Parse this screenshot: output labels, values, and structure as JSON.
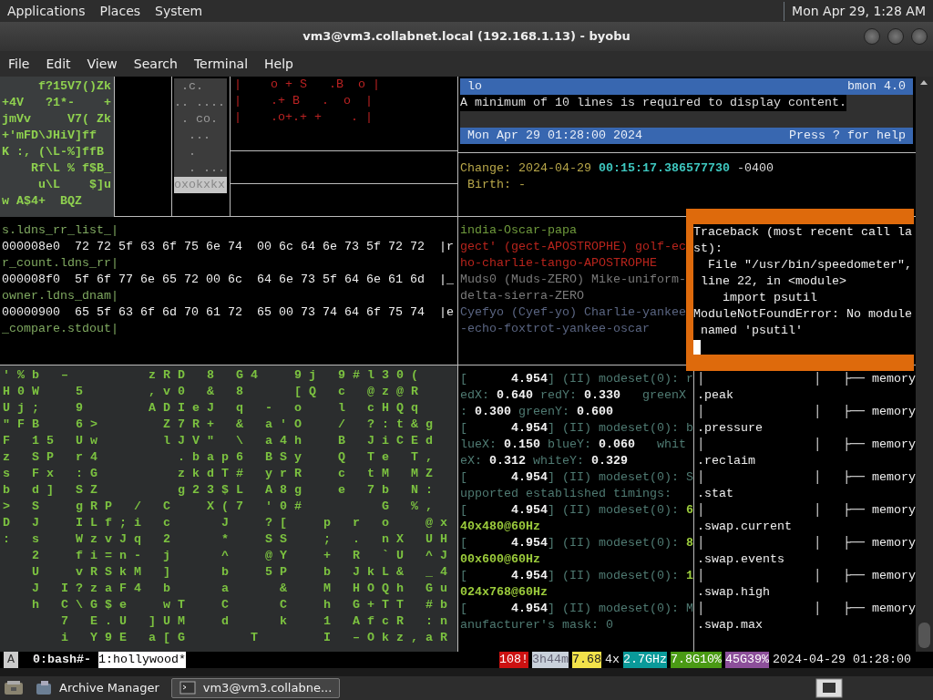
{
  "top_panel": {
    "menus": [
      "Applications",
      "Places",
      "System"
    ],
    "clock": "Mon Apr 29, 1:28 AM"
  },
  "window": {
    "title": "vm3@vm3.collabnet.local (192.168.1.13) - byobu"
  },
  "menu_bar": [
    "File",
    "Edit",
    "View",
    "Search",
    "Terminal",
    "Help"
  ],
  "matrix_small": [
    "     f?15V7()Zk",
    "+4V   ?1*-    +",
    "jmVv     V7( Zk",
    "+'mFD\\JHiV]ff",
    "K :, (\\L-%]ffB",
    "    Rf\\L % f$B_",
    "     u\\L    $]u",
    "w A$4+  BQZ"
  ],
  "shade_pane": [
    {
      "text": " .c.",
      "selected": false
    },
    {
      "text": ".. ....",
      "selected": false
    },
    {
      "text": " . co.",
      "selected": false
    },
    {
      "text": "  ...",
      "selected": false
    },
    {
      "text": "  .",
      "selected": false
    },
    {
      "text": "  . ...",
      "selected": false
    },
    {
      "text": "oxokxkx",
      "selected": true
    }
  ],
  "randomart": [
    "|    o + S   .B  o |",
    "|    .+ B   .  o  |",
    "|    .o+.+ +    . |"
  ],
  "bmon": {
    "interface": "lo",
    "version": "bmon 4.0",
    "message": "A minimum of 10 lines is required to display content.",
    "date": "Mon Apr 29 01:28:00 2024",
    "help": "Press ? for help"
  },
  "stat": {
    "change_label": "Change:",
    "change_date": "2024-04-29",
    "change_time": "00:15:17.386577730",
    "change_zone": "-0400",
    "birth": " Birth: -"
  },
  "hexdump": [
    {
      "text": "s.ldns_rr_list_|",
      "kind": "ascii"
    },
    {
      "text": "000008e0  72 72 5f 63 6f 75 6e 74  00 6c 64 6e 73 5f 72 72  |r",
      "kind": "hex"
    },
    {
      "text": "r_count.ldns_rr|",
      "kind": "ascii"
    },
    {
      "text": "000008f0  5f 6f 77 6e 65 72 00 6c  64 6e 73 5f 64 6e 61 6d  |_",
      "kind": "hex"
    },
    {
      "text": "owner.ldns_dnam|",
      "kind": "ascii"
    },
    {
      "text": "00000900  65 5f 63 6f 6d 70 61 72  65 00 73 74 64 6f 75 74  |e",
      "kind": "hex"
    },
    {
      "text": "_compare.stdout|",
      "kind": "ascii"
    }
  ],
  "words": [
    {
      "text": "india-Oscar-papa",
      "color": "#6f9a3c"
    },
    {
      "text": "gect' (gect-APOSTROPHE) golf-ec",
      "color": "#b8241c"
    },
    {
      "text": "ho-charlie-tango-APOSTROPHE",
      "color": "#b8241c"
    },
    {
      "text": "Muds0 (Muds-ZERO) Mike-uniform-",
      "color": "#7a7a7a"
    },
    {
      "text": "delta-sierra-ZERO",
      "color": "#7a7a7a"
    },
    {
      "text": "Cyefyo (Cyef-yo) Charlie-yankee",
      "color": "#5a6582"
    },
    {
      "text": "-echo-foxtrot-yankee-oscar",
      "color": "#5a6582"
    }
  ],
  "traceback": {
    "lines": [
      "Traceback (most recent call la",
      "st):",
      "  File \"/usr/bin/speedometer\",",
      " line 22, in <module>",
      "    import psutil",
      "ModuleNotFoundError: No module",
      " named 'psutil'"
    ],
    "cursor": true
  },
  "matrix_rain": [
    "'%b –     zRD 8 G4  9j 9#l30(",
    "H0W  5    ,v0 & 8   [Q c @z@R",
    "Uj;  9    ADIeJ q - o  l cHQq",
    "\"FB  6>    Z7R+ & a'O  / ?:t&g",
    "F 15 Uw    lJV\" \\ a4h  B JiCEd",
    "z SP r4     .bap6 BSy  Q Te T,",
    "s Fx :G     zkdT# yrR  c tM MZ",
    "b d] SZ     g23$L A8g  e 7b N:",
    "> S  gRP / C  X(7 '0#     G %,",
    "D J  ILf;i c   J  ?[  p r o  @x",
    ": s  WzvJq 2   *  SS  ; . nX UH",
    "  2  fi=n- j   ^  @Y  + R `U ^J",
    "  U  vRSkM ]   b  5P  b JkL& _4",
    "  J I?zaF4 b   a   &  M HOQh Gu",
    "  h C\\G$e  wT  C   C  h G+TT #b",
    "    7 E.U ]UM  d   k  1 AfcR :n",
    "    i Y9E a[G    T    I –Okz,aR"
  ],
  "dmesg": [
    [
      {
        "text": "[      ",
        "kind": "dim"
      },
      {
        "text": "4.954",
        "kind": "bold"
      },
      {
        "text": "] (II) modeset(0): r",
        "kind": "dim"
      }
    ],
    [
      {
        "text": "edX: ",
        "kind": "dim"
      },
      {
        "text": "0.640",
        "kind": "bold"
      },
      {
        "text": " redY: ",
        "kind": "dim"
      },
      {
        "text": "0.330",
        "kind": "bold"
      },
      {
        "text": "   greenX",
        "kind": "dim"
      }
    ],
    [
      {
        "text": ": ",
        "kind": "dim"
      },
      {
        "text": "0.300",
        "kind": "bold"
      },
      {
        "text": " greenY: ",
        "kind": "dim"
      },
      {
        "text": "0.600",
        "kind": "bold"
      }
    ],
    [
      {
        "text": "[      ",
        "kind": "dim"
      },
      {
        "text": "4.954",
        "kind": "bold"
      },
      {
        "text": "] (II) modeset(0): b",
        "kind": "dim"
      }
    ],
    [
      {
        "text": "lueX: ",
        "kind": "dim"
      },
      {
        "text": "0.150",
        "kind": "bold"
      },
      {
        "text": " blueY: ",
        "kind": "dim"
      },
      {
        "text": "0.060",
        "kind": "bold"
      },
      {
        "text": "   whit",
        "kind": "dim"
      }
    ],
    [
      {
        "text": "eX: ",
        "kind": "dim"
      },
      {
        "text": "0.312",
        "kind": "bold"
      },
      {
        "text": " whiteY: ",
        "kind": "dim"
      },
      {
        "text": "0.329",
        "kind": "bold"
      }
    ],
    [
      {
        "text": "[      ",
        "kind": "dim"
      },
      {
        "text": "4.954",
        "kind": "bold"
      },
      {
        "text": "] (II) modeset(0): S",
        "kind": "dim"
      }
    ],
    [
      {
        "text": "upported established timings:",
        "kind": "dim"
      }
    ],
    [
      {
        "text": "[      ",
        "kind": "dim"
      },
      {
        "text": "4.954",
        "kind": "bold"
      },
      {
        "text": "] (II) modeset(0): ",
        "kind": "dim"
      },
      {
        "text": "6",
        "kind": "green"
      }
    ],
    [
      {
        "text": "40x480@60Hz",
        "kind": "green"
      }
    ],
    [
      {
        "text": "[      ",
        "kind": "dim"
      },
      {
        "text": "4.954",
        "kind": "bold"
      },
      {
        "text": "] (II) modeset(0): ",
        "kind": "dim"
      },
      {
        "text": "8",
        "kind": "green"
      }
    ],
    [
      {
        "text": "00x600@60Hz",
        "kind": "green"
      }
    ],
    [
      {
        "text": "[      ",
        "kind": "dim"
      },
      {
        "text": "4.954",
        "kind": "bold"
      },
      {
        "text": "] (II) modeset(0): ",
        "kind": "dim"
      },
      {
        "text": "1",
        "kind": "green"
      }
    ],
    [
      {
        "text": "024x768@60Hz",
        "kind": "green"
      }
    ],
    [
      {
        "text": "[      ",
        "kind": "dim"
      },
      {
        "text": "4.954",
        "kind": "bold"
      },
      {
        "text": "] (II) modeset(0): M",
        "kind": "dim"
      }
    ],
    [
      {
        "text": "anufacturer's mask: 0",
        "kind": "dim"
      }
    ]
  ],
  "tree": [
    "│               │   ├── memory",
    ".peak",
    "│               │   ├── memory",
    ".pressure",
    "│               │   ├── memory",
    ".reclaim",
    "│               │   ├── memory",
    ".stat",
    "│               │   ├── memory",
    ".swap.current",
    "│               │   ├── memory",
    ".swap.events",
    "│               │   ├── memory",
    ".swap.high",
    "│               │   ├── memory",
    ".swap.max"
  ],
  "status_bar": {
    "session": "A",
    "windows": [
      {
        "label": "0:bash#-",
        "selected": false
      },
      {
        "label": "1:hollywood*",
        "selected": true
      }
    ],
    "indicators": [
      {
        "text": "108!",
        "color": "#cc1111"
      },
      {
        "text": "3h44m",
        "color": "#c9d1db"
      },
      {
        "text": "7.68",
        "color": "#f2e24a"
      },
      {
        "text": "4x"
      },
      {
        "text": "2.7GHz",
        "color": "#0a9a9a"
      },
      {
        "text": "7.8G10%",
        "color": "#4a9a14"
      },
      {
        "text": "45G39%",
        "color": "#8c4f9a"
      }
    ],
    "datetime": "2024-04-29 01:28:00"
  },
  "taskbar": {
    "items": [
      {
        "label": "Archive Manager",
        "selected": false
      },
      {
        "label": "vm3@vm3.collabne...",
        "selected": true
      }
    ]
  }
}
